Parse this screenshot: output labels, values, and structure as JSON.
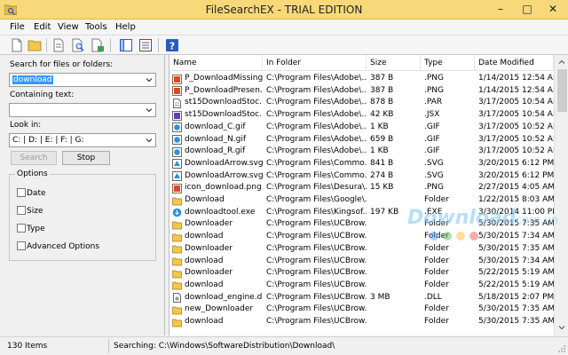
{
  "window": {
    "title": "FileSearchEX - TRIAL EDITION",
    "minimize": "–",
    "maximize": "□",
    "close": "✕",
    "accent": "#f7d97a"
  },
  "menu": [
    "File",
    "Edit",
    "View",
    "Tools",
    "Help"
  ],
  "toolbar_icons": [
    "new-icon",
    "open-folder-icon",
    "document-icon",
    "find-document-icon",
    "save-document-icon",
    "panel-icon",
    "list-view-icon",
    "help-icon"
  ],
  "search": {
    "label": "Search for files or folders:",
    "value": "download",
    "containing_label": "Containing text:",
    "containing_value": "",
    "lookin_label": "Look in:",
    "lookin_value": "C: | D: | E: | F: | G:",
    "search_button": "Search",
    "stop_button": "Stop"
  },
  "options": {
    "title": "Options",
    "items": [
      "Date",
      "Size",
      "Type",
      "Advanced Options"
    ]
  },
  "columns": [
    "Name",
    "In Folder",
    "Size",
    "Type",
    "Date Modified"
  ],
  "rows": [
    {
      "name": "P_DownloadMissing...",
      "folder": "C:\\Program Files\\Adobe\\...",
      "size": "387 B",
      "type": ".PNG",
      "date": "1/14/2015 12:54 AM",
      "icon": "png"
    },
    {
      "name": "P_DownloadPresen...",
      "folder": "C:\\Program Files\\Adobe\\...",
      "size": "387 B",
      "type": ".PNG",
      "date": "1/14/2015 12:54 AM",
      "icon": "png"
    },
    {
      "name": "st15DownloadStoc...",
      "folder": "C:\\Program Files\\Adobe\\...",
      "size": "878 B",
      "type": ".PAR",
      "date": "3/17/2005 10:54 AM",
      "icon": "doc"
    },
    {
      "name": "st15DownloadStoc...",
      "folder": "C:\\Program Files\\Adobe\\...",
      "size": "42 KB",
      "type": ".JSX",
      "date": "3/17/2005 10:54 AM",
      "icon": "jsx"
    },
    {
      "name": "download_C.gif",
      "folder": "C:\\Program Files\\Adobe\\...",
      "size": "1 KB",
      "type": ".GIF",
      "date": "3/17/2005 10:52 AM",
      "icon": "gif"
    },
    {
      "name": "download_N.gif",
      "folder": "C:\\Program Files\\Adobe\\...",
      "size": "659 B",
      "type": ".GIF",
      "date": "3/17/2005 10:52 AM",
      "icon": "gif"
    },
    {
      "name": "download_R.gif",
      "folder": "C:\\Program Files\\Adobe\\...",
      "size": "1 KB",
      "type": ".GIF",
      "date": "3/17/2005 10:52 AM",
      "icon": "gif"
    },
    {
      "name": "DownloadArrow.svg",
      "folder": "C:\\Program Files\\Commo...",
      "size": "841 B",
      "type": ".SVG",
      "date": "3/20/2015 6:12 PM",
      "icon": "svg"
    },
    {
      "name": "DownloadArrow.svg",
      "folder": "C:\\Program Files\\Commo...",
      "size": "274 B",
      "type": ".SVG",
      "date": "3/20/2015 6:12 PM",
      "icon": "svg"
    },
    {
      "name": "icon_download.png",
      "folder": "C:\\Program Files\\Desura\\...",
      "size": "15 KB",
      "type": ".PNG",
      "date": "2/27/2015 4:05 AM",
      "icon": "png"
    },
    {
      "name": "Download",
      "folder": "C:\\Program Files\\Google\\...",
      "size": "",
      "type": "Folder",
      "date": "1/22/2015 8:03 AM",
      "icon": "folder"
    },
    {
      "name": "downloadtool.exe",
      "folder": "C:\\Program Files\\Kingsof...",
      "size": "197 KB",
      "type": ".EXE",
      "date": "3/30/2014 11:00 PM",
      "icon": "exe"
    },
    {
      "name": "Downloader",
      "folder": "C:\\Program Files\\UCBrow...",
      "size": "",
      "type": "Folder",
      "date": "5/30/2015 7:35 AM",
      "icon": "folder"
    },
    {
      "name": "download",
      "folder": "C:\\Program Files\\UCBrow...",
      "size": "",
      "type": "Folder",
      "date": "5/30/2015 7:34 AM",
      "icon": "folder"
    },
    {
      "name": "Downloader",
      "folder": "C:\\Program Files\\UCBrow...",
      "size": "",
      "type": "Folder",
      "date": "5/30/2015 7:35 AM",
      "icon": "folder"
    },
    {
      "name": "download",
      "folder": "C:\\Program Files\\UCBrow...",
      "size": "",
      "type": "Folder",
      "date": "5/30/2015 7:34 AM",
      "icon": "folder"
    },
    {
      "name": "Downloader",
      "folder": "C:\\Program Files\\UCBrow...",
      "size": "",
      "type": "Folder",
      "date": "5/22/2015 5:19 AM",
      "icon": "folder"
    },
    {
      "name": "download",
      "folder": "C:\\Program Files\\UCBrow...",
      "size": "",
      "type": "Folder",
      "date": "5/22/2015 5:19 AM",
      "icon": "folder"
    },
    {
      "name": "download_engine.dll",
      "folder": "C:\\Program Files\\UCBrow...",
      "size": "3 MB",
      "type": ".DLL",
      "date": "5/18/2015 2:07 PM",
      "icon": "dll"
    },
    {
      "name": "new_Downloader",
      "folder": "C:\\Program Files\\UCBrow...",
      "size": "",
      "type": "Folder",
      "date": "5/30/2015 7:35 AM",
      "icon": "folder"
    },
    {
      "name": "download",
      "folder": "C:\\Program Files\\UCBrow...",
      "size": "",
      "type": "Folder",
      "date": "5/30/2015 7:35 AM",
      "icon": "folder"
    }
  ],
  "status": {
    "count": "130 Items",
    "searching": "Searching:  C:\\Windows\\SoftwareDistribution\\Download\\"
  },
  "watermark": {
    "text": "Download",
    "suffix": ".com.vn"
  }
}
